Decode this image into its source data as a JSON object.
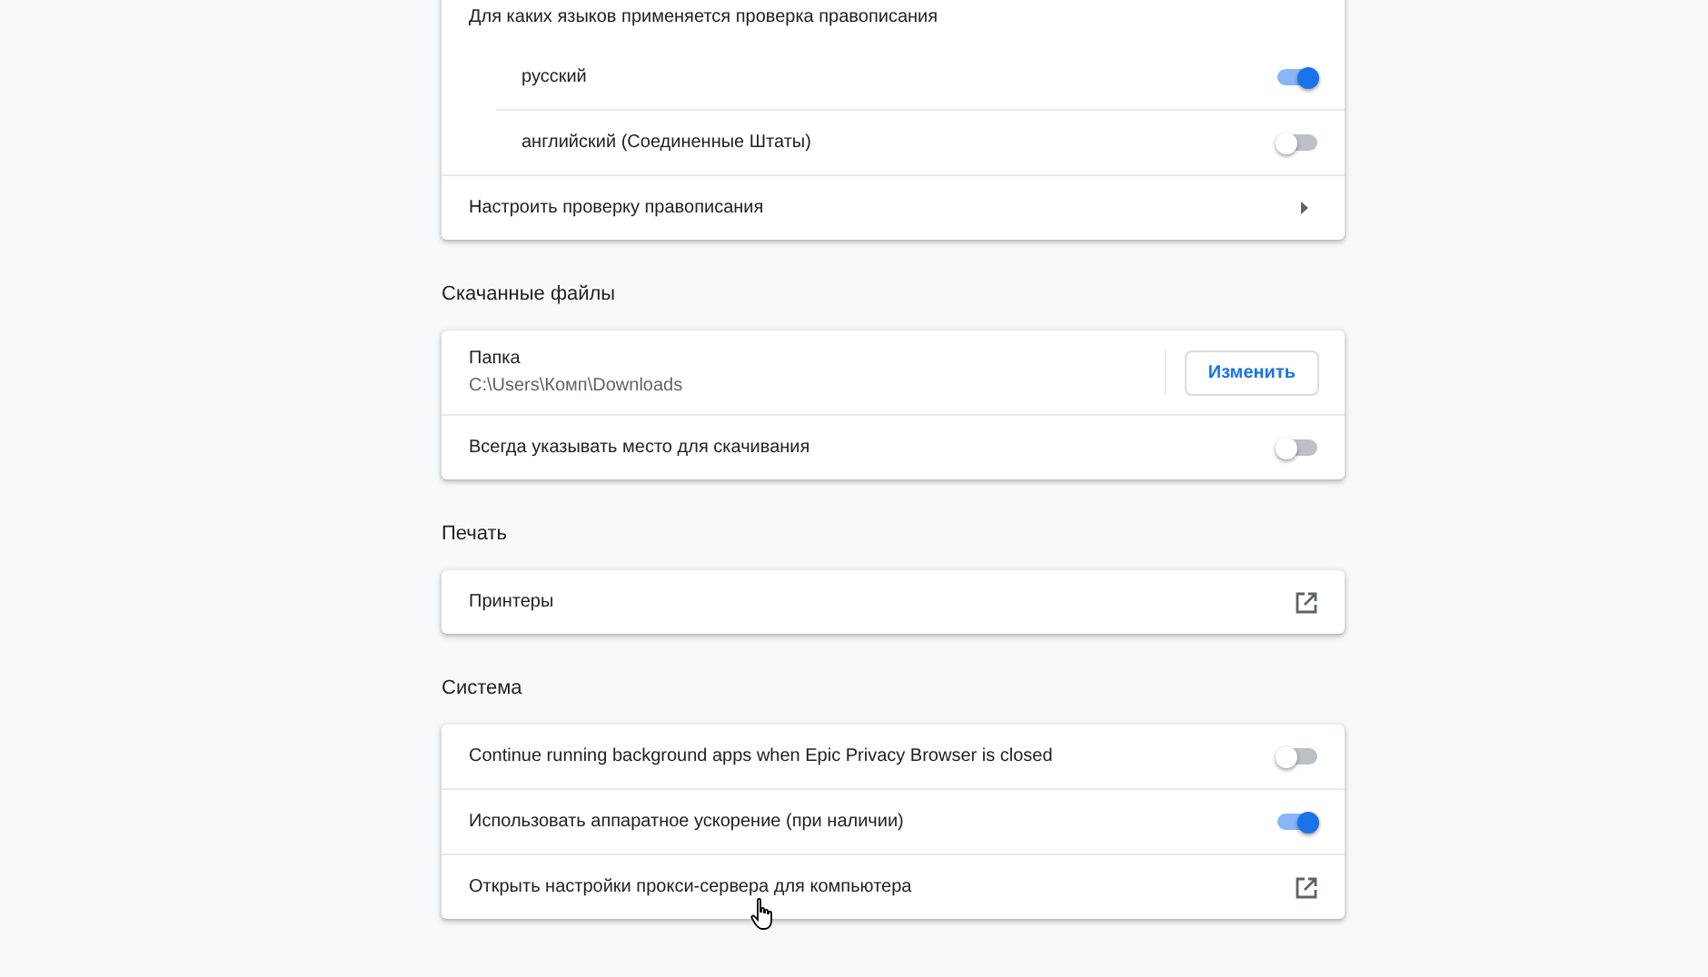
{
  "sections": [
    {
      "rows": [
        {
          "kind": "group",
          "label": "Для каких языков применяется проверка правописания",
          "children": [
            {
              "kind": "toggle",
              "label": "русский",
              "on": true
            },
            {
              "kind": "toggle",
              "label": "английский (Соединенные Штаты)",
              "on": false
            }
          ]
        },
        {
          "kind": "arrow",
          "label": "Настроить проверку правописания"
        }
      ]
    },
    {
      "title": "Скачанные файлы",
      "rows": [
        {
          "kind": "folder",
          "label": "Папка",
          "sublabel": "C:\\Users\\Комп\\Downloads",
          "button": "Изменить"
        },
        {
          "kind": "toggle",
          "label": "Всегда указывать место для скачивания",
          "on": false
        }
      ]
    },
    {
      "title": "Печать",
      "rows": [
        {
          "kind": "external",
          "label": "Принтеры"
        }
      ]
    },
    {
      "title": "Система",
      "rows": [
        {
          "kind": "toggle",
          "label": "Continue running background apps when Epic Privacy Browser is closed",
          "on": false
        },
        {
          "kind": "toggle",
          "label": "Использовать аппаратное ускорение (при наличии)",
          "on": true
        },
        {
          "kind": "external",
          "label": "Открыть настройки прокси-сервера для компьютера"
        }
      ]
    }
  ]
}
